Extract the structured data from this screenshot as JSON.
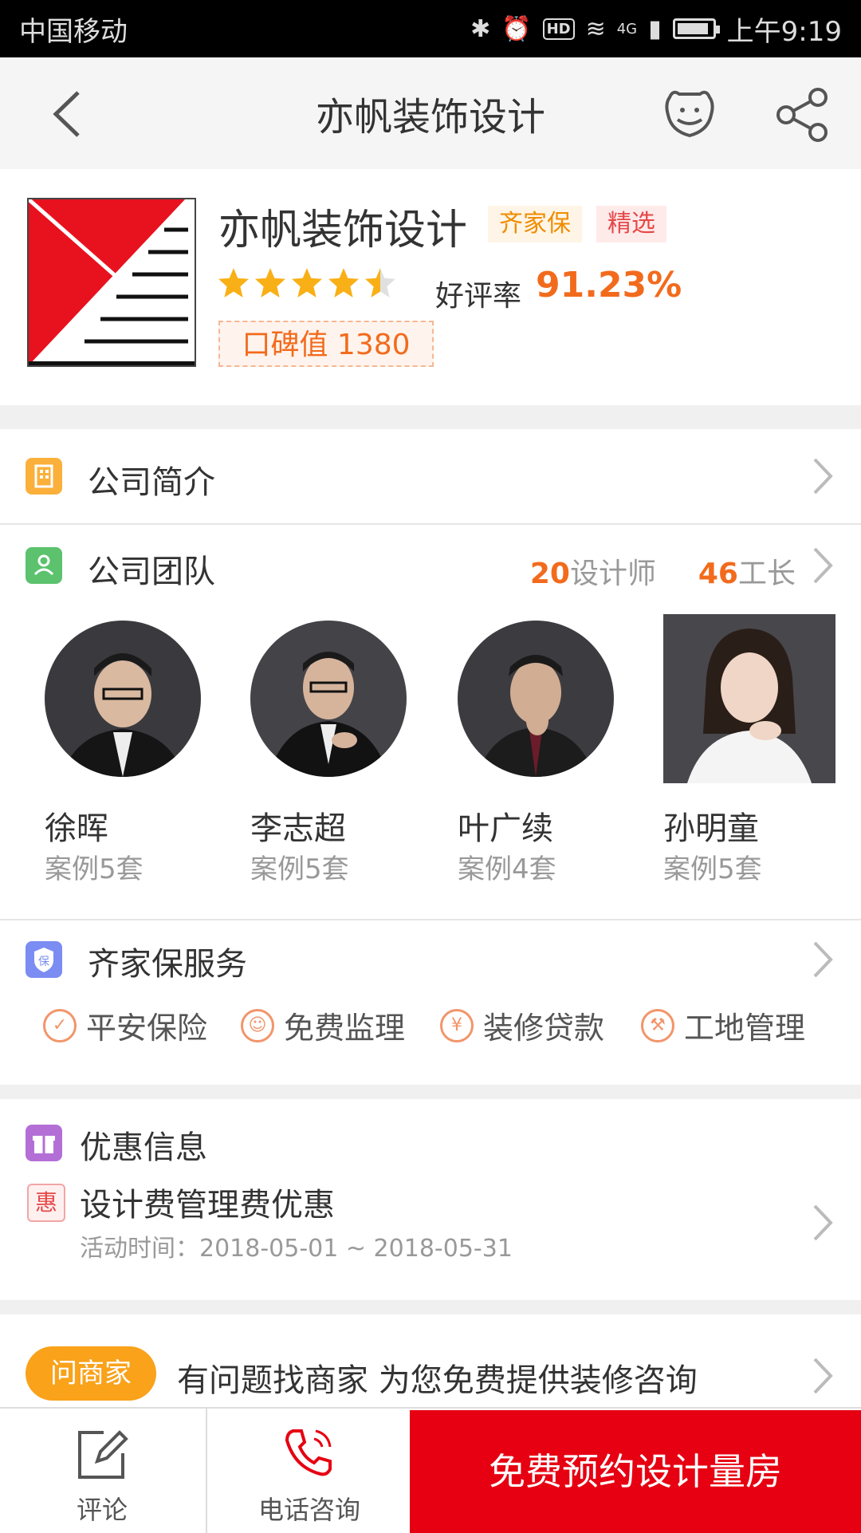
{
  "status_bar": {
    "carrier": "中国移动",
    "time": "上午9:19",
    "network": "4G",
    "hd": "HD"
  },
  "nav": {
    "title": "亦帆装饰设计",
    "icons": [
      "back-icon",
      "customer-service-icon",
      "share-icon"
    ]
  },
  "company": {
    "name": "亦帆装饰设计",
    "tags": [
      "齐家保",
      "精选"
    ],
    "rating_stars": 4.5,
    "rate_label": "好评率",
    "rate_value": "91.23%",
    "reputation": "口碑值 1380"
  },
  "intro": {
    "label": "公司简介"
  },
  "team": {
    "label": "公司团队",
    "designers_count": "20",
    "designers_label": "设计师",
    "foremen_count": "46",
    "foremen_label": "工长",
    "members": [
      {
        "name": "徐晖",
        "cases": "案例5套"
      },
      {
        "name": "李志超",
        "cases": "案例5套"
      },
      {
        "name": "叶广续",
        "cases": "案例4套"
      },
      {
        "name": "孙明童",
        "cases": "案例5套"
      }
    ]
  },
  "services": {
    "label": "齐家保服务",
    "items": [
      "平安保险",
      "免费监理",
      "装修贷款",
      "工地管理"
    ]
  },
  "promo": {
    "label": "优惠信息",
    "badge": "惠",
    "title": "设计费管理费优惠",
    "time": "活动时间：2018-05-01 ~ 2018-05-31"
  },
  "ask": {
    "button": "问商家",
    "text": "有问题找商家 为您免费提供装修咨询"
  },
  "bottom": {
    "comment": "评论",
    "phone": "电话咨询",
    "cta": "免费预约设计量房"
  },
  "colors": {
    "accent": "#f26b1d",
    "cta": "#e60012",
    "ask": "#f9a21a"
  }
}
